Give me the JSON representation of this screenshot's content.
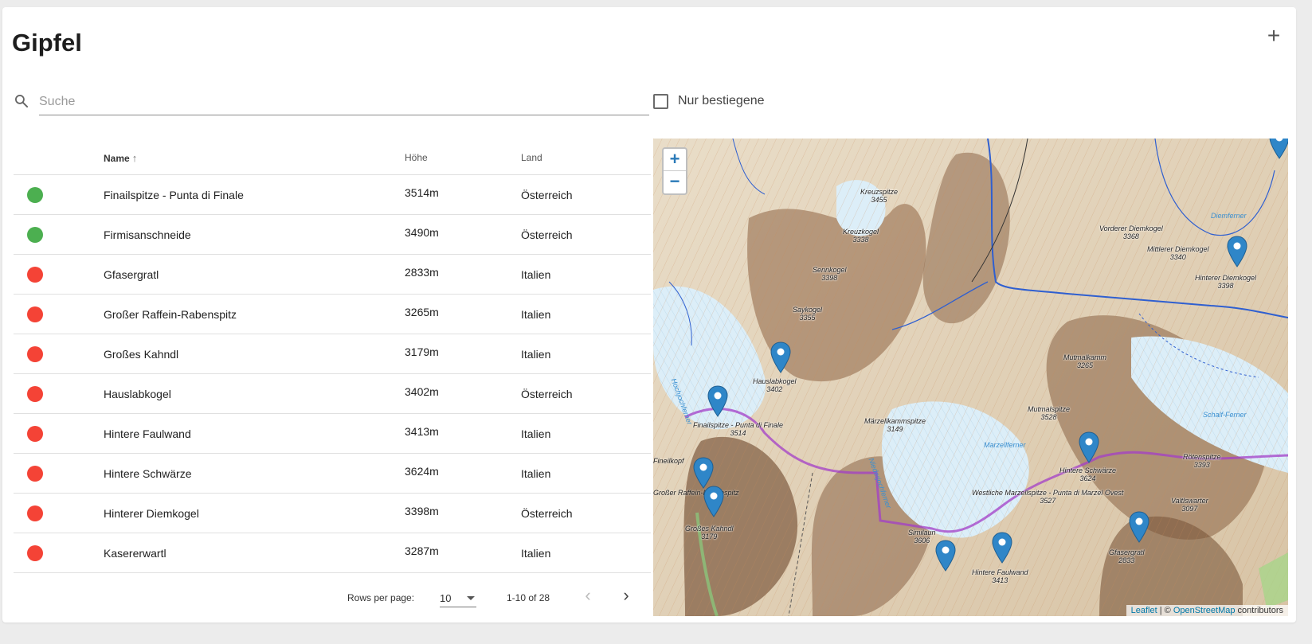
{
  "page": {
    "title": "Gipfel",
    "add_label": "+"
  },
  "search": {
    "placeholder": "Suche",
    "value": ""
  },
  "filter": {
    "nur_bestiegene_label": "Nur bestiegene",
    "checked": false
  },
  "table": {
    "columns": {
      "name": "Name",
      "hoehe": "Höhe",
      "land": "Land"
    },
    "sort": {
      "column": "Name",
      "direction": "ascending"
    },
    "rows": [
      {
        "status": "climbed",
        "status_color": "#4caf50",
        "name": "Finailspitze - Punta di Finale",
        "hoehe": "3514m",
        "land": "Österreich"
      },
      {
        "status": "climbed",
        "status_color": "#4caf50",
        "name": "Firmisanschneide",
        "hoehe": "3490m",
        "land": "Österreich"
      },
      {
        "status": "not-climbed",
        "status_color": "#f44336",
        "name": "Gfasergratl",
        "hoehe": "2833m",
        "land": "Italien"
      },
      {
        "status": "not-climbed",
        "status_color": "#f44336",
        "name": "Großer Raffein-Rabenspitz",
        "hoehe": "3265m",
        "land": "Italien"
      },
      {
        "status": "not-climbed",
        "status_color": "#f44336",
        "name": "Großes Kahndl",
        "hoehe": "3179m",
        "land": "Italien"
      },
      {
        "status": "not-climbed",
        "status_color": "#f44336",
        "name": "Hauslabkogel",
        "hoehe": "3402m",
        "land": "Österreich"
      },
      {
        "status": "not-climbed",
        "status_color": "#f44336",
        "name": "Hintere Faulwand",
        "hoehe": "3413m",
        "land": "Italien"
      },
      {
        "status": "not-climbed",
        "status_color": "#f44336",
        "name": "Hintere Schwärze",
        "hoehe": "3624m",
        "land": "Italien"
      },
      {
        "status": "not-climbed",
        "status_color": "#f44336",
        "name": "Hinterer Diemkogel",
        "hoehe": "3398m",
        "land": "Österreich"
      },
      {
        "status": "not-climbed",
        "status_color": "#f44336",
        "name": "Kasererwartl",
        "hoehe": "3287m",
        "land": "Italien"
      }
    ]
  },
  "pagination": {
    "rows_per_page_label": "Rows per page:",
    "rows_per_page_value": "10",
    "range": "1-10 of 28",
    "prev_icon": "chevron-left-icon",
    "next_icon": "chevron-right-icon"
  },
  "map": {
    "zoom_in": "+",
    "zoom_out": "−",
    "attribution": {
      "leaflet": "Leaflet",
      "separator": " | © ",
      "osm": "OpenStreetMap",
      "suffix": " contributors"
    },
    "labels": [
      {
        "name": "Kreuzspitze",
        "elev": "3455"
      },
      {
        "name": "Kreuzkogel",
        "elev": "3338"
      },
      {
        "name": "Sennkogel",
        "elev": "3398"
      },
      {
        "name": "Saykogel",
        "elev": "3355"
      },
      {
        "name": "Vorderer Diemkogel",
        "elev": "3368"
      },
      {
        "name": "Mittlerer Diemkogel",
        "elev": "3340"
      },
      {
        "name": "Hinterer Diemkogel",
        "elev": "3398"
      },
      {
        "name": "Hauslabkogel",
        "elev": "3402"
      },
      {
        "name": "Mutmalkamm",
        "elev": "3265"
      },
      {
        "name": "Mutmalspitze",
        "elev": "3528"
      },
      {
        "name": "Finailspitze - Punta di Finale",
        "elev": "3514"
      },
      {
        "name": "Märzellkammspitze",
        "elev": "3149"
      },
      {
        "name": "Hintere Schwärze",
        "elev": "3624"
      },
      {
        "name": "Rötenspitze",
        "elev": "3393"
      },
      {
        "name": "Westliche Marzellspitze - Punta di Marzel Ovest",
        "elev": "3527"
      },
      {
        "name": "Großes Kahndl",
        "elev": "3179"
      },
      {
        "name": "Similaun",
        "elev": "3606"
      },
      {
        "name": "Hintere Faulwand",
        "elev": "3413"
      },
      {
        "name": "Gfasergratl",
        "elev": "2833"
      },
      {
        "name": "Valtlswarter",
        "elev": "3097"
      }
    ],
    "water_labels": [
      "Schalf-Ferner",
      "Marzellferner",
      "Niederjochferner",
      "Hochjochferner",
      "Diemferner"
    ],
    "other_labels": [
      "Großer Raffein-Rabenspitz",
      "Fineilkopf"
    ]
  }
}
